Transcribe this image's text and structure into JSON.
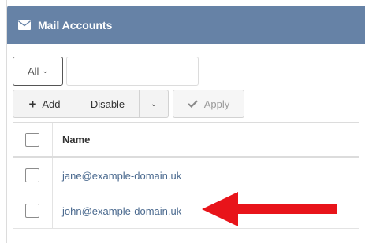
{
  "panel": {
    "title": "Mail Accounts",
    "icon": "envelope-icon",
    "header_color": "#6682a6"
  },
  "filter": {
    "select_value": "All",
    "input_value": "",
    "input_placeholder": ""
  },
  "toolbar": {
    "add_label": "Add",
    "disable_label": "Disable",
    "apply_label": "Apply"
  },
  "table": {
    "columns": [
      "Name"
    ],
    "rows": [
      {
        "name": "jane@example-domain.uk"
      },
      {
        "name": "john@example-domain.uk"
      }
    ]
  },
  "annotation": {
    "arrow_color": "#e8141a"
  }
}
